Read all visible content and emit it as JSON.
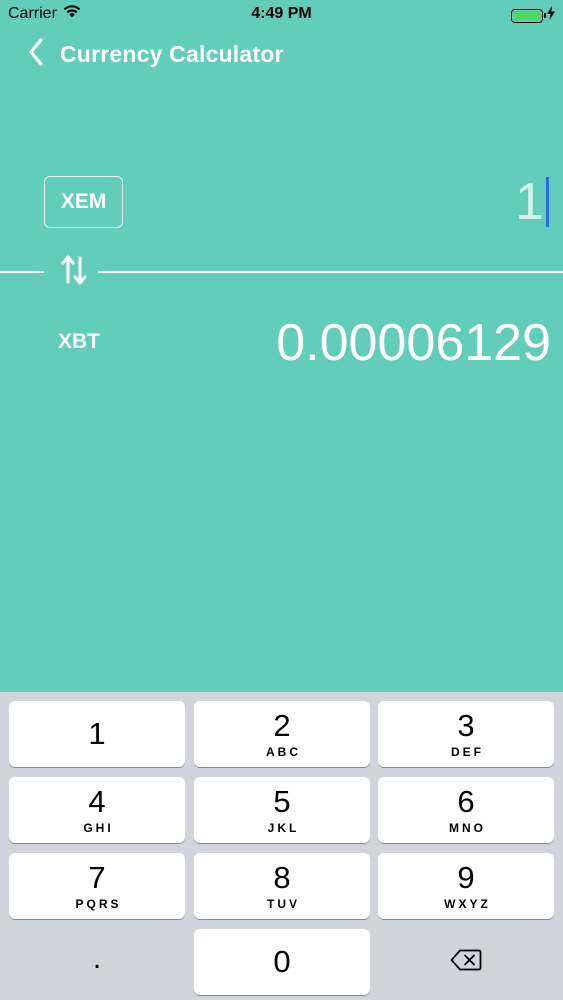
{
  "status_bar": {
    "carrier": "Carrier",
    "time": "4:49 PM",
    "battery_level": 1.0,
    "icons": [
      "wifi-icon",
      "battery-icon",
      "charging-bolt-icon"
    ]
  },
  "nav": {
    "title": "Currency Calculator",
    "back_icon": "chevron-left-icon"
  },
  "converter": {
    "from_currency": "XEM",
    "amount": "1",
    "swap_icon": "swap-arrows-icon",
    "to_currency": "XBT",
    "converted_value": "0.00006129"
  },
  "keypad": {
    "keys": [
      {
        "num": "1",
        "letters": ""
      },
      {
        "num": "2",
        "letters": "ABC"
      },
      {
        "num": "3",
        "letters": "DEF"
      },
      {
        "num": "4",
        "letters": "GHI"
      },
      {
        "num": "5",
        "letters": "JKL"
      },
      {
        "num": "6",
        "letters": "MNO"
      },
      {
        "num": "7",
        "letters": "PQRS"
      },
      {
        "num": "8",
        "letters": "TUV"
      },
      {
        "num": "9",
        "letters": "WXYZ"
      }
    ],
    "decimal": ".",
    "zero": "0",
    "delete_icon": "backspace-icon"
  },
  "colors": {
    "background": "#62CDBB",
    "caret": "#2B6BE0",
    "keyboard": "#D1D5DB",
    "battery": "#4CD964"
  }
}
